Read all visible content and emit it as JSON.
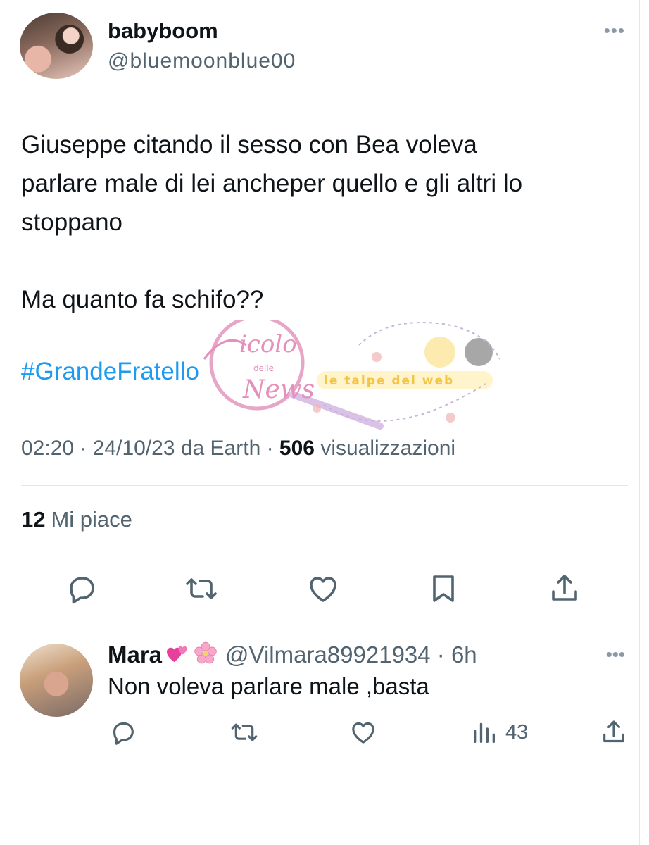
{
  "tweet": {
    "display_name": "babyboom",
    "handle": "@bluemoonblue00",
    "more_icon": "more-horizontal-icon",
    "text_lines": [
      "Giuseppe citando il sesso con Bea voleva",
      "parlare male di lei ancheper quello e gli altri lo",
      "stoppano"
    ],
    "text_second": "Ma quanto fa schifo??",
    "hashtag": "#GrandeFratello",
    "meta_time": "02:20 · 24/10/23 da Earth · ",
    "meta_views": "506",
    "meta_views_label": " visualizzazioni",
    "likes_count": "12",
    "likes_label": "Mi piace",
    "accent_color": "#1d9bf0"
  },
  "watermark": {
    "logo_text_top": "icolo",
    "logo_text_mid": "delle",
    "logo_text_bottom": "News",
    "banner_text": "le talpe del web"
  },
  "actions": [
    "reply-icon",
    "retweet-icon",
    "like-icon",
    "bookmark-icon",
    "share-icon"
  ],
  "reply": {
    "display_name": "Mara",
    "emojis": [
      "hearts-emoji",
      "cherry-blossom-emoji"
    ],
    "handle_time": "@Vilmara89921934 · 6h",
    "text": "Non voleva parlare male ,basta",
    "views": "43"
  }
}
